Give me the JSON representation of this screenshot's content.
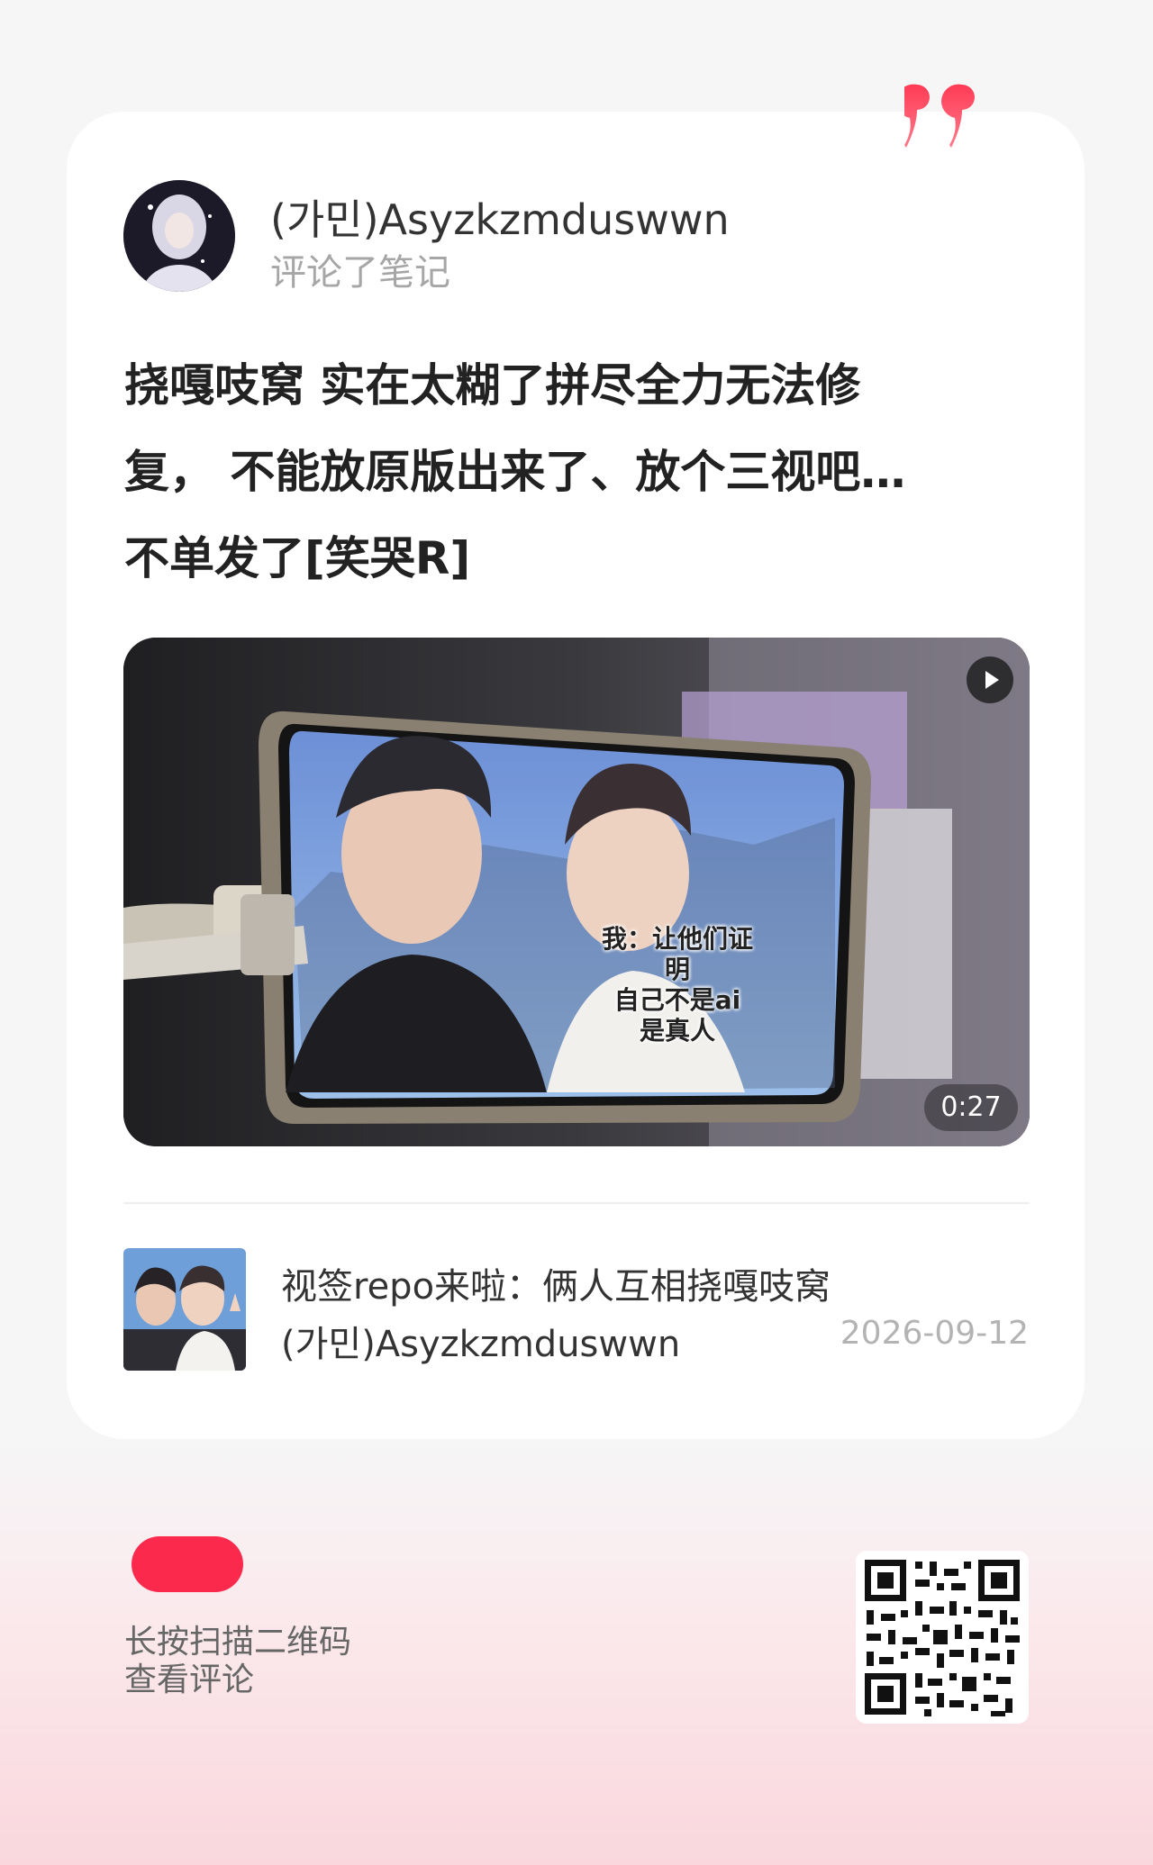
{
  "comment": {
    "username": "(가민)Asyzkzmduswwn",
    "action": "评论了笔记",
    "content_lines": [
      "挠嘎吱窝 实在太糊了拼尽全力无法修",
      "复， 不能放原版出来了、放个三视吧…",
      "不单发了[笑哭R]"
    ]
  },
  "video": {
    "duration": "0:27",
    "caption_lines": [
      "我：让他们证明",
      "自己不是ai",
      "是真人"
    ]
  },
  "note": {
    "title": "视签repo来啦：俩人互相挠嘎吱窝",
    "author": "(가민)Asyzkzmduswwn",
    "date": "2026-09-12"
  },
  "footer": {
    "hint_lines": [
      "长按扫描二维码",
      "查看评论"
    ]
  },
  "colors": {
    "brand": "#fb2a4c",
    "quote": "#fb2a4c"
  }
}
